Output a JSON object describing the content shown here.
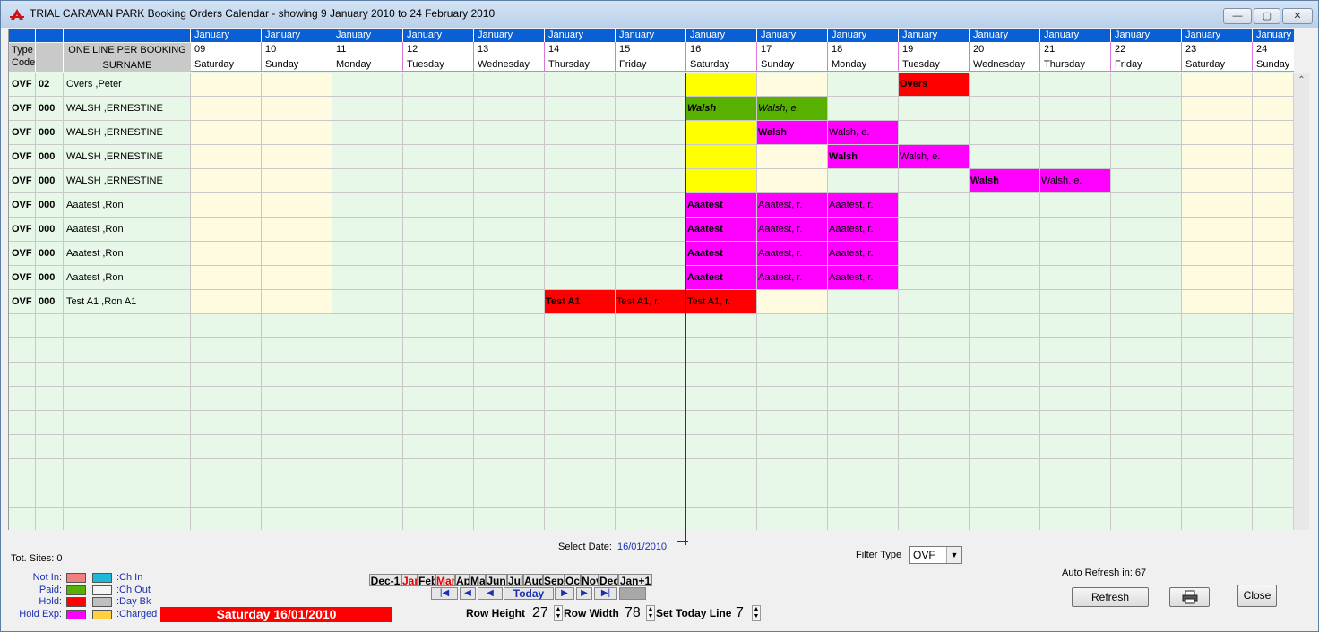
{
  "window": {
    "title": "TRIAL CARAVAN PARK Booking Orders Calendar - showing  9 January 2010  to  24 February 2010",
    "min_glyph": "—",
    "max_glyph": "▢",
    "close_glyph": "✕"
  },
  "header": {
    "type_label": "Type",
    "code_label": "Code",
    "booking_label": "ONE LINE PER BOOKING",
    "surname_label": "SURNAME"
  },
  "days": [
    {
      "month": "January",
      "day": "09",
      "dow": "Saturday"
    },
    {
      "month": "January",
      "day": "10",
      "dow": "Sunday"
    },
    {
      "month": "January",
      "day": "11",
      "dow": "Monday"
    },
    {
      "month": "January",
      "day": "12",
      "dow": "Tuesday"
    },
    {
      "month": "January",
      "day": "13",
      "dow": "Wednesday"
    },
    {
      "month": "January",
      "day": "14",
      "dow": "Thursday"
    },
    {
      "month": "January",
      "day": "15",
      "dow": "Friday"
    },
    {
      "month": "January",
      "day": "16",
      "dow": "Saturday"
    },
    {
      "month": "January",
      "day": "17",
      "dow": "Sunday"
    },
    {
      "month": "January",
      "day": "18",
      "dow": "Monday"
    },
    {
      "month": "January",
      "day": "19",
      "dow": "Tuesday"
    },
    {
      "month": "January",
      "day": "20",
      "dow": "Wednesday"
    },
    {
      "month": "January",
      "day": "21",
      "dow": "Thursday"
    },
    {
      "month": "January",
      "day": "22",
      "dow": "Friday"
    },
    {
      "month": "January",
      "day": "23",
      "dow": "Saturday"
    },
    {
      "month": "January",
      "day": "24",
      "dow": "Sunday"
    }
  ],
  "rows": [
    {
      "type": "OVF",
      "code": "02",
      "name": "Overs ,Peter",
      "cells": [
        {
          "day": 7,
          "color": "#ffff00",
          "text": ""
        },
        {
          "day": 10,
          "color": "#ff0000",
          "text": "Overs",
          "bold": true
        }
      ]
    },
    {
      "type": "OVF",
      "code": "000",
      "name": "WALSH ,ERNESTINE",
      "cells": [
        {
          "day": 7,
          "color": "#58b000",
          "text": "Walsh",
          "bold": true,
          "italic": true
        },
        {
          "day": 8,
          "color": "#58b000",
          "text": "Walsh, e.",
          "italic": true
        }
      ]
    },
    {
      "type": "OVF",
      "code": "000",
      "name": "WALSH ,ERNESTINE",
      "cells": [
        {
          "day": 7,
          "color": "#ffff00",
          "text": ""
        },
        {
          "day": 8,
          "color": "#ff00ff",
          "text": "Walsh",
          "bold": true
        },
        {
          "day": 9,
          "color": "#ff00ff",
          "text": "Walsh, e."
        }
      ]
    },
    {
      "type": "OVF",
      "code": "000",
      "name": "WALSH ,ERNESTINE",
      "cells": [
        {
          "day": 7,
          "color": "#ffff00",
          "text": ""
        },
        {
          "day": 9,
          "color": "#ff00ff",
          "text": "Walsh",
          "bold": true
        },
        {
          "day": 10,
          "color": "#ff00ff",
          "text": "Walsh, e."
        }
      ]
    },
    {
      "type": "OVF",
      "code": "000",
      "name": "WALSH ,ERNESTINE",
      "cells": [
        {
          "day": 7,
          "color": "#ffff00",
          "text": ""
        },
        {
          "day": 11,
          "color": "#ff00ff",
          "text": "Walsh",
          "bold": true
        },
        {
          "day": 12,
          "color": "#ff00ff",
          "text": "Walsh, e."
        }
      ]
    },
    {
      "type": "OVF",
      "code": "000",
      "name": "Aaatest ,Ron",
      "cells": [
        {
          "day": 7,
          "color": "#ff00ff",
          "text": "Aaatest",
          "bold": true
        },
        {
          "day": 8,
          "color": "#ff00ff",
          "text": "Aaatest, r."
        },
        {
          "day": 9,
          "color": "#ff00ff",
          "text": "Aaatest, r."
        }
      ]
    },
    {
      "type": "OVF",
      "code": "000",
      "name": "Aaatest ,Ron",
      "cells": [
        {
          "day": 7,
          "color": "#ff00ff",
          "text": "Aaatest",
          "bold": true
        },
        {
          "day": 8,
          "color": "#ff00ff",
          "text": "Aaatest, r."
        },
        {
          "day": 9,
          "color": "#ff00ff",
          "text": "Aaatest, r."
        }
      ]
    },
    {
      "type": "OVF",
      "code": "000",
      "name": "Aaatest ,Ron",
      "cells": [
        {
          "day": 7,
          "color": "#ff00ff",
          "text": "Aaatest",
          "bold": true
        },
        {
          "day": 8,
          "color": "#ff00ff",
          "text": "Aaatest, r."
        },
        {
          "day": 9,
          "color": "#ff00ff",
          "text": "Aaatest, r."
        }
      ]
    },
    {
      "type": "OVF",
      "code": "000",
      "name": "Aaatest ,Ron",
      "cells": [
        {
          "day": 7,
          "color": "#ff00ff",
          "text": "Aaatest",
          "bold": true
        },
        {
          "day": 8,
          "color": "#ff00ff",
          "text": "Aaatest, r."
        },
        {
          "day": 9,
          "color": "#ff00ff",
          "text": "Aaatest, r."
        }
      ]
    },
    {
      "type": "OVF",
      "code": "000",
      "name": "Test A1 ,Ron A1",
      "cells": [
        {
          "day": 5,
          "color": "#ff0000",
          "text": "Test A1",
          "bold": true
        },
        {
          "day": 6,
          "color": "#ff0000",
          "text": "Test A1, r."
        },
        {
          "day": 7,
          "color": "#ff0000",
          "text": "Test A1, r."
        }
      ]
    }
  ],
  "weekend_color": "#fffbe0",
  "weekday_color": "#e8f8e8",
  "footer": {
    "tot_sites": "Tot. Sites:  0",
    "select_date_label": "Select Date:",
    "select_date_value": "16/01/2010",
    "filter_label": "Filter Type",
    "filter_value": "OVF",
    "auto_refresh": "Auto Refresh in:   67",
    "refresh": "Refresh",
    "close": "Close",
    "today_banner": "Saturday 16/01/2010",
    "today_btn": "Today",
    "row_height_label": "Row Height",
    "row_height_value": "27",
    "row_width_label": "Row Width",
    "row_width_value": "78",
    "today_line_label": "Set Today Line",
    "today_line_value": "7"
  },
  "legend": {
    "left": [
      {
        "label": "Not In:",
        "color": "#f08080"
      },
      {
        "label": "Paid:",
        "color": "#58b000"
      },
      {
        "label": "Hold:",
        "color": "#ff0000"
      },
      {
        "label": "Hold Exp:",
        "color": "#ff00ff"
      }
    ],
    "right": [
      {
        "label": ":Ch In",
        "color": "#20b8d8"
      },
      {
        "label": ":Ch Out",
        "color": "#f4f4f4"
      },
      {
        "label": ":Day Bk",
        "color": "#c0c0c0"
      },
      {
        "label": ":Charged",
        "color": "#ffd040"
      }
    ]
  },
  "months": [
    {
      "label": "Dec-1",
      "red": false
    },
    {
      "label": "Jan",
      "red": true
    },
    {
      "label": "Feb",
      "red": false
    },
    {
      "label": "Mar",
      "red": true
    },
    {
      "label": "Apr",
      "red": false
    },
    {
      "label": "May",
      "red": false
    },
    {
      "label": "Jun",
      "red": false
    },
    {
      "label": "Jul",
      "red": false
    },
    {
      "label": "Aug",
      "red": false
    },
    {
      "label": "Sep",
      "red": false
    },
    {
      "label": "Oct",
      "red": false
    },
    {
      "label": "Nov",
      "red": false
    },
    {
      "label": "Dec",
      "red": false
    },
    {
      "label": "Jan+1",
      "red": false
    }
  ]
}
